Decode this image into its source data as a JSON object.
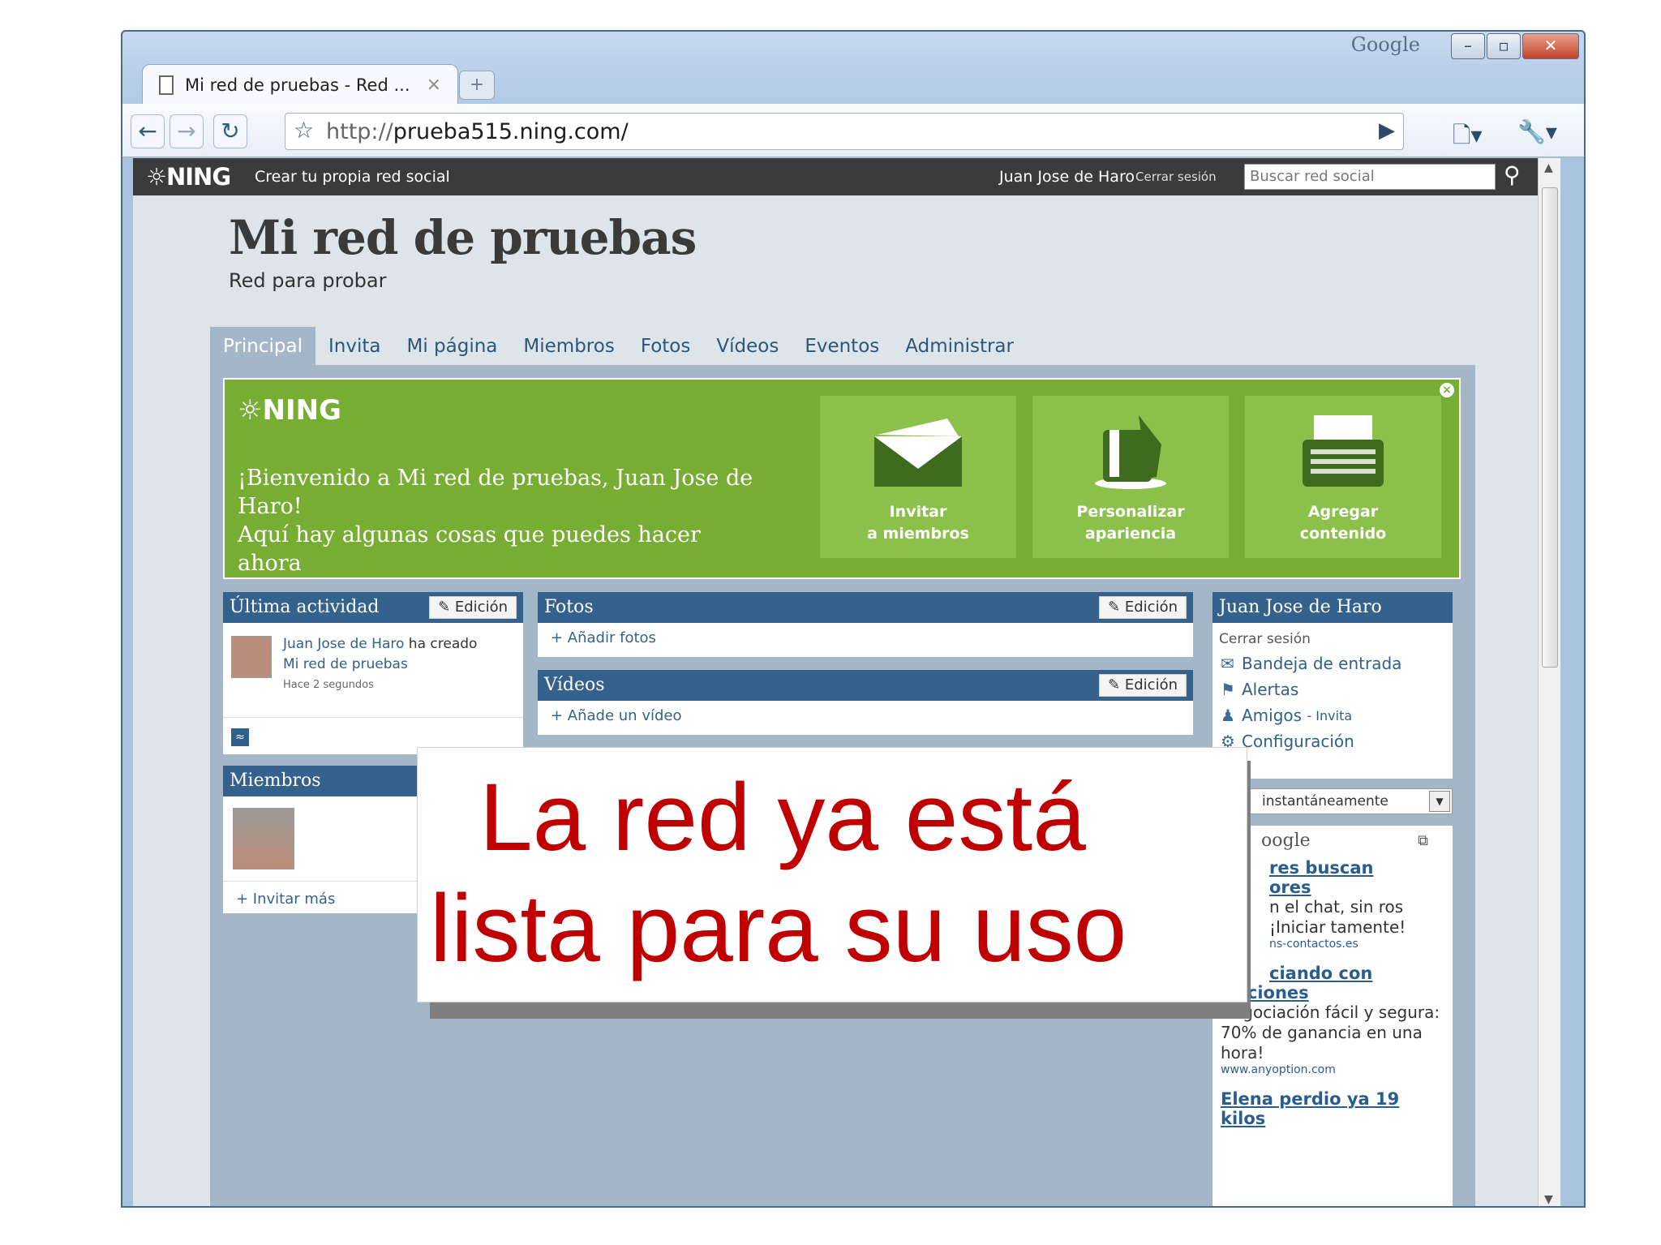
{
  "browser": {
    "google_label": "Google",
    "tab_title": "Mi red de pruebas - Red ...",
    "tab_close": "×",
    "newtab": "+",
    "url_proto": "http://",
    "url_host": "prueba515.ning.com/"
  },
  "ning": {
    "logo": "NING",
    "create": "Crear tu propia red social",
    "user": "Juan Jose de Haro",
    "logout": "Cerrar sesión",
    "search_placeholder": "Buscar red social"
  },
  "site": {
    "title": "Mi red de pruebas",
    "subtitle": "Red para probar"
  },
  "nav": [
    "Principal",
    "Invita",
    "Mi página",
    "Miembros",
    "Fotos",
    "Vídeos",
    "Eventos",
    "Administrar"
  ],
  "welcome": {
    "logo": "NING",
    "line1": "¡Bienvenido a Mi red de pruebas, Juan Jose de Haro!",
    "line2": "Aquí hay algunas cosas que puedes hacer ahora",
    "cards": [
      {
        "l1": "Invitar",
        "l2": "a miembros"
      },
      {
        "l1": "Personalizar",
        "l2": "apariencia"
      },
      {
        "l1": "Agregar",
        "l2": "contenido"
      }
    ]
  },
  "activity": {
    "title": "Última actividad",
    "edit": "Edición",
    "user": "Juan Jose de Haro",
    "action": "ha creado",
    "object": "Mi red de pruebas",
    "time": "Hace 2 segundos"
  },
  "members": {
    "title": "Miembros",
    "invite": "+ Invitar más"
  },
  "photos": {
    "title": "Fotos",
    "edit": "Edición",
    "add": "+ Añadir fotos"
  },
  "videos": {
    "title": "Vídeos",
    "edit": "Edición",
    "add": "+ Añade un vídeo"
  },
  "profile": {
    "title": "Juan Jose de Haro",
    "logout": "Cerrar sesión",
    "links": [
      "Bandeja de entrada",
      "Alertas",
      "Amigos",
      "Configuración"
    ],
    "friends_invite": "- Invita",
    "dropdown": "instantáneamente"
  },
  "ads": {
    "label": "oogle",
    "items": [
      {
        "title1": "res buscan",
        "title2": "ores",
        "text": "n el chat, sin ros ¡Iniciar tamente!",
        "url": "ns-contactos.es"
      },
      {
        "title1": "ciando con",
        "title2": "Opciones",
        "text": "Negociación fácil y segura: 70% de ganancia en una hora!",
        "url": "www.anyoption.com"
      },
      {
        "title1": "Elena perdio ya 19",
        "title2": "kilos",
        "text": "",
        "url": ""
      }
    ]
  },
  "overlay": {
    "line1": "La red ya está",
    "line2": "lista para su uso"
  }
}
